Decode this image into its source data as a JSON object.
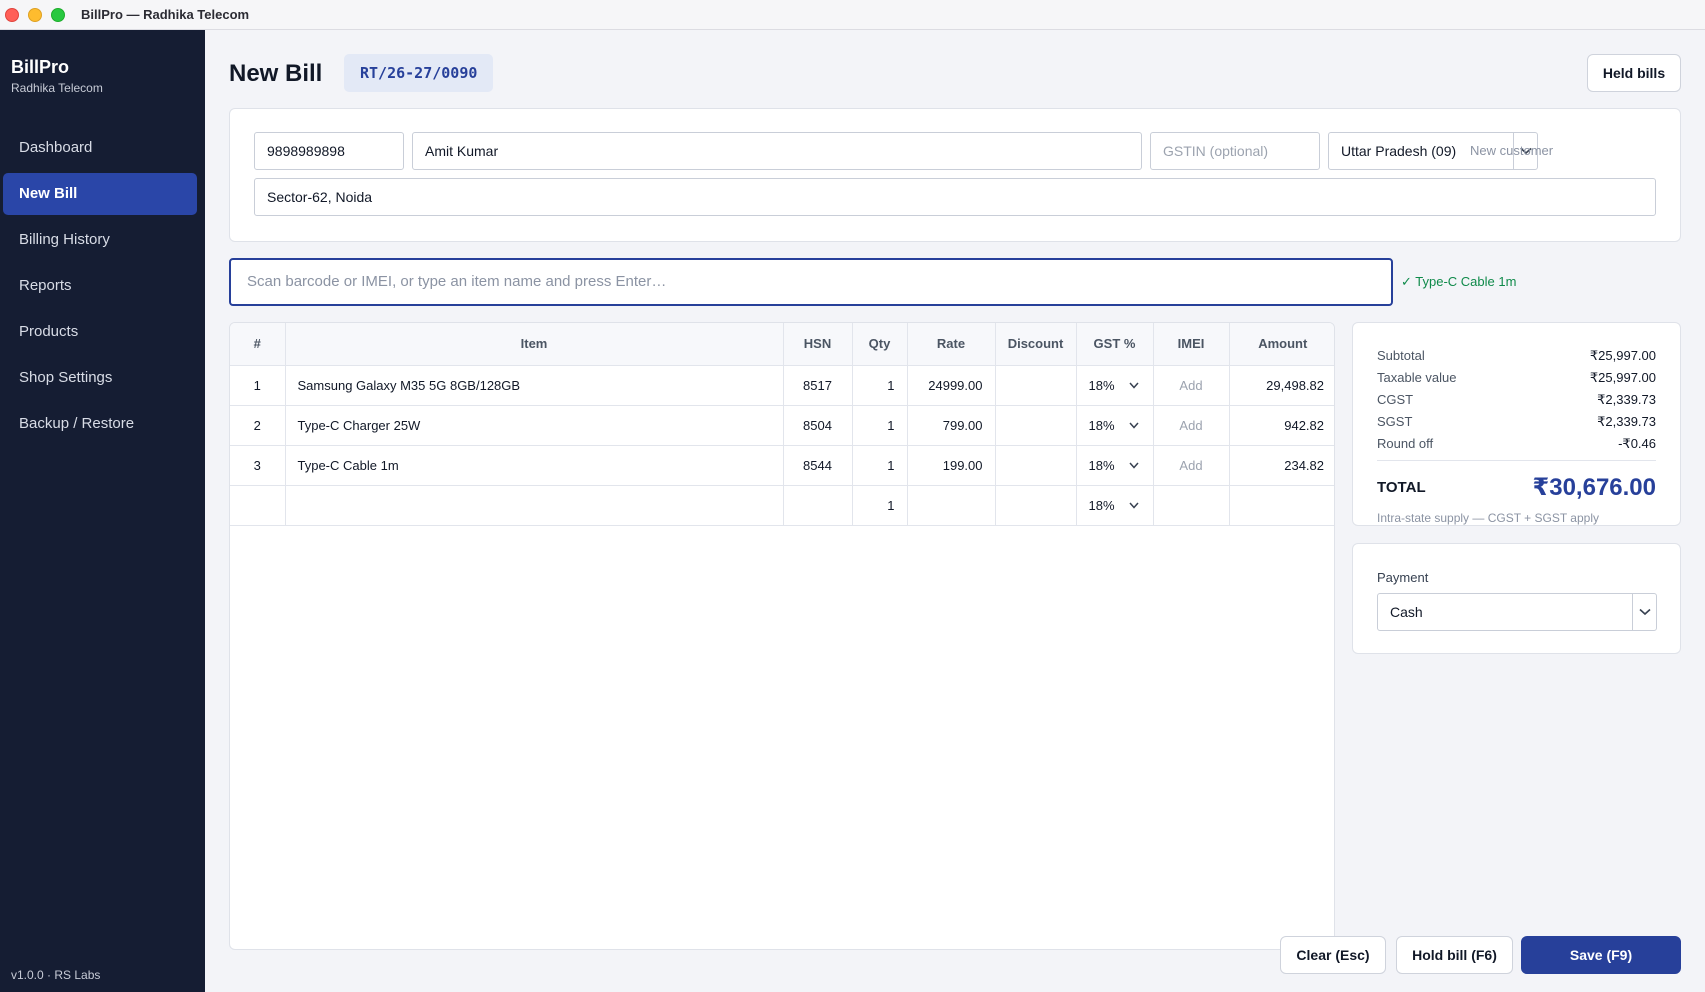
{
  "window": {
    "title": "BillPro — Radhika Telecom"
  },
  "sidebar": {
    "brand": "BillPro",
    "shop": "Radhika Telecom",
    "items": [
      {
        "label": "Dashboard"
      },
      {
        "label": "New Bill"
      },
      {
        "label": "Billing History"
      },
      {
        "label": "Reports"
      },
      {
        "label": "Products"
      },
      {
        "label": "Shop Settings"
      },
      {
        "label": "Backup / Restore"
      }
    ],
    "active": "New Bill",
    "version": "v1.0.0 · RS Labs"
  },
  "header": {
    "title": "New Bill",
    "bill_number": "RT/26-27/0090",
    "held_bills_label": "Held bills"
  },
  "customer": {
    "phone": "9898989898",
    "name": "Amit Kumar",
    "gstin_placeholder": "GSTIN (optional)",
    "state": "Uttar Pradesh (09)",
    "status": "New customer",
    "address": "Sector-62, Noida"
  },
  "scan": {
    "placeholder": "Scan barcode or IMEI, or type an item name and press Enter…",
    "last_added": "✓ Type-C Cable 1m"
  },
  "items_table": {
    "columns": [
      "#",
      "Item",
      "HSN",
      "Qty",
      "Rate",
      "Discount",
      "GST %",
      "IMEI",
      "Amount"
    ],
    "rows": [
      {
        "no": "1",
        "item": "Samsung Galaxy M35 5G 8GB/128GB",
        "hsn": "8517",
        "qty": "1",
        "rate": "24999.00",
        "discount": "",
        "gst": "18%",
        "imei": "Add",
        "amount": "29,498.82"
      },
      {
        "no": "2",
        "item": "Type-C Charger 25W",
        "hsn": "8504",
        "qty": "1",
        "rate": "799.00",
        "discount": "",
        "gst": "18%",
        "imei": "Add",
        "amount": "942.82"
      },
      {
        "no": "3",
        "item": "Type-C Cable 1m",
        "hsn": "8544",
        "qty": "1",
        "rate": "199.00",
        "discount": "",
        "gst": "18%",
        "imei": "Add",
        "amount": "234.82"
      },
      {
        "no": "",
        "item": "",
        "hsn": "",
        "qty": "1",
        "rate": "",
        "discount": "",
        "gst": "18%",
        "imei": "",
        "amount": ""
      }
    ]
  },
  "totals": {
    "subtotal_label": "Subtotal",
    "subtotal": "₹25,997.00",
    "taxable_label": "Taxable value",
    "taxable": "₹25,997.00",
    "cgst_label": "CGST",
    "cgst": "₹2,339.73",
    "sgst_label": "SGST",
    "sgst": "₹2,339.73",
    "roundoff_label": "Round off",
    "roundoff": "-₹0.46",
    "total_label": "TOTAL",
    "total": "₹30,676.00",
    "note": "Intra-state supply — CGST + SGST apply"
  },
  "payment": {
    "label": "Payment",
    "method": "Cash"
  },
  "actions": {
    "clear_label": "Clear  (Esc)",
    "hold_label": "Hold bill  (F6)",
    "save_label": "Save  (F9)"
  },
  "colors": {
    "sidebar_bg": "#151d33",
    "accent": "#27409a",
    "nav_active": "#2a46a8",
    "success": "#0f8a4a"
  }
}
